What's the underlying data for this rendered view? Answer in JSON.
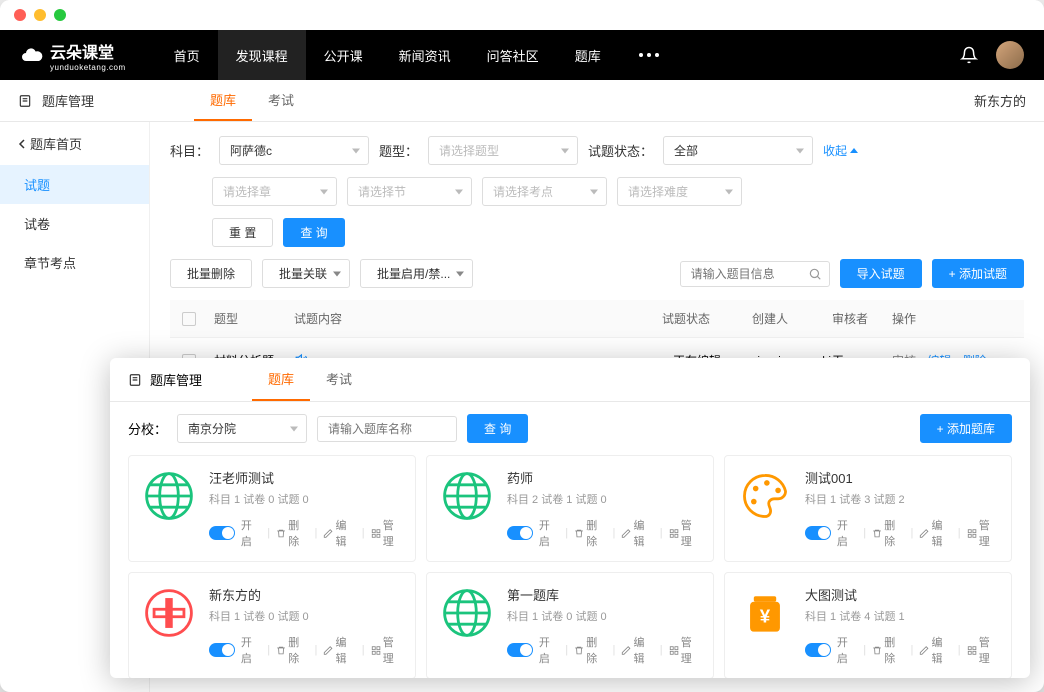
{
  "logo": {
    "text": "云朵课堂",
    "sub": "yunduoketang.com"
  },
  "nav": {
    "items": [
      "首页",
      "发现课程",
      "公开课",
      "新闻资讯",
      "问答社区",
      "题库"
    ],
    "active_index": 1
  },
  "window1": {
    "title": "题库管理",
    "tabs": [
      "题库",
      "考试"
    ],
    "tabs_active": 0,
    "breadcrumb_right": "新东方的",
    "sidebar": {
      "back": "题库首页",
      "items": [
        "试题",
        "试卷",
        "章节考点"
      ],
      "active_index": 0
    },
    "filters": {
      "subject_label": "科目：",
      "subject_value": "阿萨德c",
      "type_label": "题型：",
      "type_placeholder": "请选择题型",
      "status_label": "试题状态：",
      "status_value": "全部",
      "collapse": "收起",
      "chapter_placeholder": "请选择章",
      "section_placeholder": "请选择节",
      "kp_placeholder": "请选择考点",
      "difficulty_placeholder": "请选择难度",
      "reset_btn": "重 置",
      "query_btn": "查 询"
    },
    "batch": {
      "delete": "批量删除",
      "relate": "批量关联",
      "toggle": "批量启用/禁...",
      "search_placeholder": "请输入题目信息",
      "import_btn": "导入试题",
      "add_btn": "+ 添加试题"
    },
    "table": {
      "headers": [
        "题型",
        "试题内容",
        "试题状态",
        "创建人",
        "审核者",
        "操作"
      ],
      "rows": [
        {
          "type": "材料分析题",
          "has_audio": true,
          "status": "正在编辑",
          "creator": "xiaoqiang_ceshi",
          "reviewer": "无",
          "ops": [
            "审核",
            "编辑",
            "删除"
          ]
        }
      ]
    }
  },
  "window2": {
    "title": "题库管理",
    "tabs": [
      "题库",
      "考试"
    ],
    "tabs_active": 0,
    "filter": {
      "school_label": "分校：",
      "school_value": "南京分院",
      "name_placeholder": "请输入题库名称",
      "query_btn": "查 询",
      "add_btn": "+ 添加题库"
    },
    "cards": [
      {
        "title": "汪老师测试",
        "meta": "科目 1  试卷 0  试题 0",
        "icon": "globe"
      },
      {
        "title": "药师",
        "meta": "科目 2  试卷 1  试题 0",
        "icon": "globe"
      },
      {
        "title": "测试001",
        "meta": "科目 1  试卷 3  试题 2",
        "icon": "palette"
      },
      {
        "title": "新东方的",
        "meta": "科目 1  试卷 0  试题 0",
        "icon": "cn"
      },
      {
        "title": "第一题库",
        "meta": "科目 1  试卷 0  试题 0",
        "icon": "globe"
      },
      {
        "title": "大图测试",
        "meta": "科目 1  试卷 4  试题 1",
        "icon": "jar"
      }
    ],
    "card_actions": {
      "open": "开启",
      "delete": "删除",
      "edit": "编辑",
      "manage": "管理"
    }
  }
}
